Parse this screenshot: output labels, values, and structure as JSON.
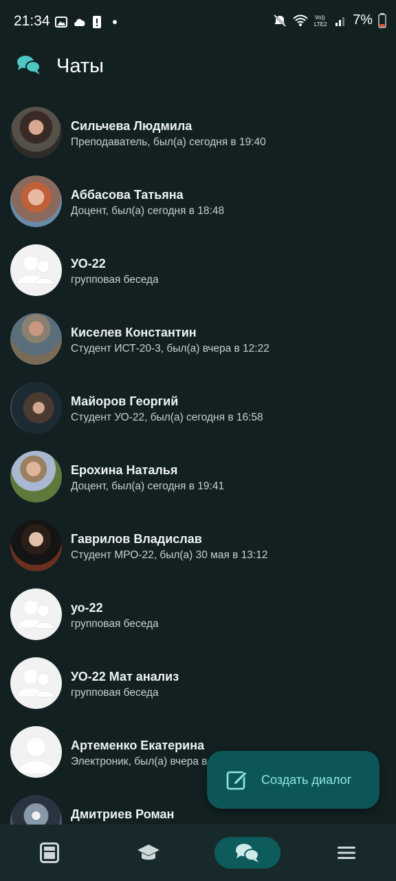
{
  "status_bar": {
    "time": "21:34",
    "battery": "7%",
    "left_icons": [
      "image-icon",
      "cloud-icon",
      "alert-icon",
      "dot-icon"
    ],
    "right_icons": [
      "mute-icon",
      "wifi-icon",
      "volte-lte2-icon",
      "signal-icon",
      "battery-low-icon"
    ]
  },
  "header": {
    "title": "Чаты",
    "icon": "chat-bubbles-icon"
  },
  "chats": [
    {
      "name": "Сильчева Людмила",
      "subtitle": "Преподаватель, был(а) сегодня в 19:40",
      "avatar": "photo"
    },
    {
      "name": "Аббасова Татьяна",
      "subtitle": "Доцент, был(а) сегодня в 18:48",
      "avatar": "photo"
    },
    {
      "name": "УО-22",
      "subtitle": "групповая беседа",
      "avatar": "group"
    },
    {
      "name": "Киселев Константин",
      "subtitle": "Студент ИСТ-20-3, был(а) вчера в 12:22",
      "avatar": "photo"
    },
    {
      "name": "Майоров Георгий",
      "subtitle": "Студент УО-22, был(а) сегодня в 16:58",
      "avatar": "photo"
    },
    {
      "name": "Ерохина Наталья",
      "subtitle": "Доцент, был(а) сегодня в 19:41",
      "avatar": "photo"
    },
    {
      "name": "Гаврилов Владислав",
      "subtitle": "Студент МРО-22, был(а) 30 мая в 13:12",
      "avatar": "photo"
    },
    {
      "name": "уо-22",
      "subtitle": "групповая беседа",
      "avatar": "group"
    },
    {
      "name": "УО-22 Мат анализ",
      "subtitle": "групповая беседа",
      "avatar": "group"
    },
    {
      "name": "Артеменко Екатерина",
      "subtitle": "Электроник, был(а) вчера в",
      "avatar": "blank"
    },
    {
      "name": "Дмитриев Роман",
      "subtitle": "",
      "avatar": "photo"
    }
  ],
  "fab": {
    "label": "Создать диалог",
    "icon": "compose-icon"
  },
  "bottom_nav": [
    {
      "icon": "schedule-icon",
      "active": false
    },
    {
      "icon": "graduation-cap-icon",
      "active": false
    },
    {
      "icon": "chat-bubbles-icon",
      "active": true
    },
    {
      "icon": "menu-icon",
      "active": false
    }
  ],
  "colors": {
    "background": "#122022",
    "accent": "#0d5657",
    "accent_text": "#8ee9e4",
    "nav_background": "#18292b"
  }
}
